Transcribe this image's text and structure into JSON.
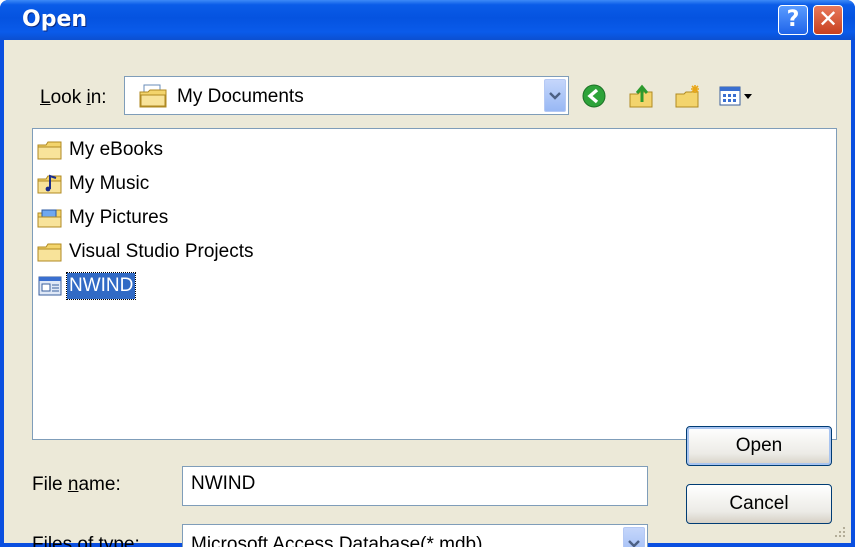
{
  "window": {
    "title": "Open"
  },
  "titlebar": {
    "help_label": "?",
    "close_label": "✕"
  },
  "lookin": {
    "label": "Look in:",
    "value": "My Documents",
    "toolbar_icons": [
      "back-icon",
      "up-folder-icon",
      "new-folder-icon",
      "views-menu-icon"
    ]
  },
  "files": [
    {
      "name": "My eBooks",
      "icon": "folder-icon",
      "selected": false
    },
    {
      "name": "My Music",
      "icon": "music-folder-icon",
      "selected": false
    },
    {
      "name": "My Pictures",
      "icon": "pictures-folder-icon",
      "selected": false
    },
    {
      "name": "Visual Studio Projects",
      "icon": "folder-icon",
      "selected": false
    },
    {
      "name": "NWIND",
      "icon": "database-icon",
      "selected": true
    }
  ],
  "filename": {
    "label": "File name:",
    "value": "NWIND"
  },
  "filetype": {
    "label": "Files of type:",
    "value": "Microsoft Access Database(*.mdb)"
  },
  "buttons": {
    "open": "Open",
    "cancel": "Cancel"
  },
  "colors": {
    "titlebar": "#0553e0",
    "selection": "#316ac5",
    "dialog_bg": "#ece9d8"
  }
}
